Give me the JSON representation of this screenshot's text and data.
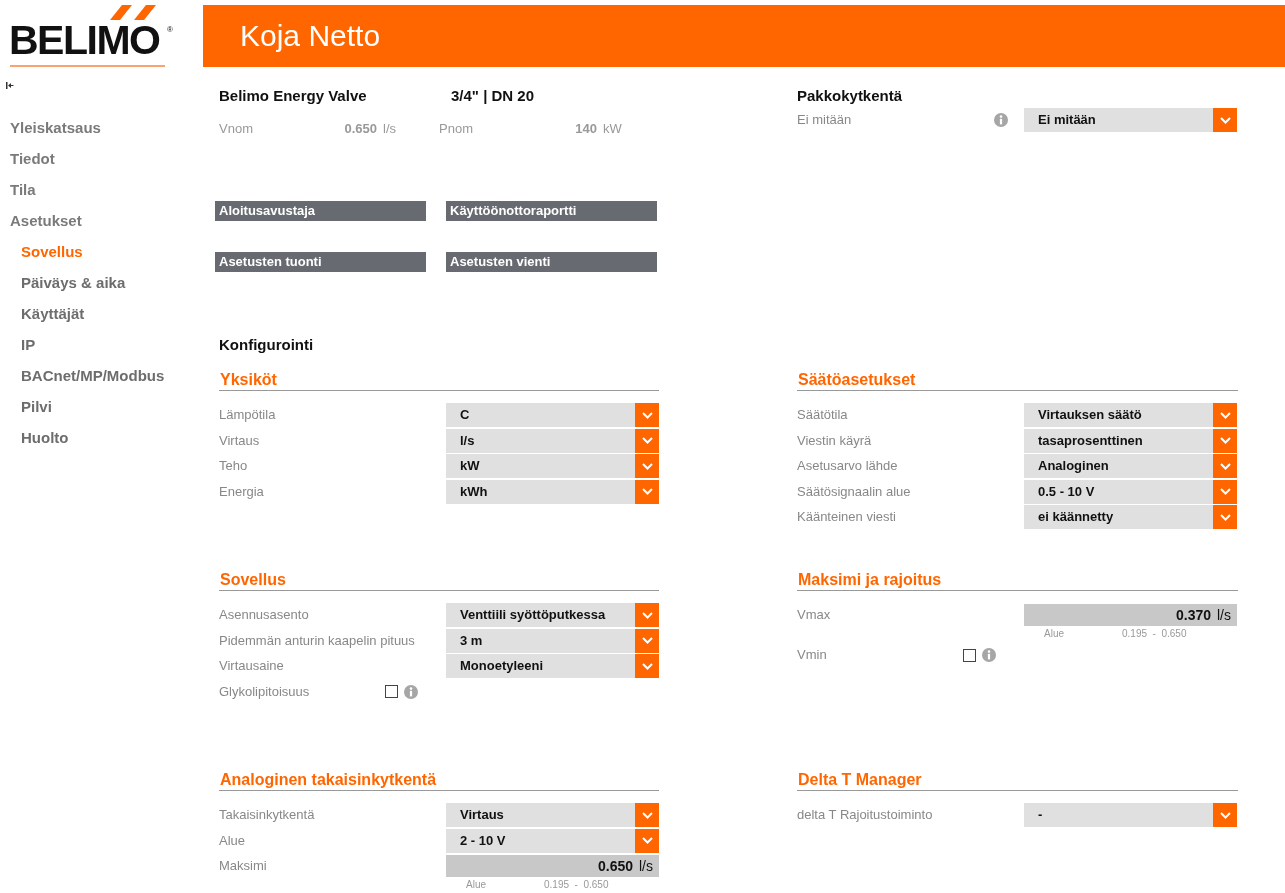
{
  "logo": {
    "text": "BELIMO",
    "mark": "®"
  },
  "header": {
    "title": "Koja Netto"
  },
  "sidebar": {
    "items": [
      {
        "label": "Yleiskatsaus",
        "selected": false
      },
      {
        "label": "Tiedot",
        "selected": false
      },
      {
        "label": "Tila",
        "selected": false
      },
      {
        "label": "Asetukset",
        "selected": false,
        "children": [
          {
            "label": "Sovellus",
            "selected": true
          },
          {
            "label": "Päiväys & aika",
            "selected": false
          },
          {
            "label": "Käyttäjät",
            "selected": false
          },
          {
            "label": "IP",
            "selected": false
          },
          {
            "label": "BACnet/MP/Modbus",
            "selected": false
          },
          {
            "label": "Pilvi",
            "selected": false
          },
          {
            "label": "Huolto",
            "selected": false
          }
        ]
      }
    ]
  },
  "device": {
    "name": "Belimo Energy Valve",
    "size": "3/4\" | DN 20",
    "specs": [
      {
        "label": "Vnom",
        "value": "0.650",
        "unit": "l/s"
      },
      {
        "label": "Pnom",
        "value": "140",
        "unit": "kW"
      }
    ]
  },
  "action_buttons": [
    "Aloitusavustaja",
    "Käyttöönottoraportti",
    "Asetusten tuonti",
    "Asetusten vienti"
  ],
  "override": {
    "title": "Pakkokytkentä",
    "rows": [
      {
        "kind": "select",
        "label": "Ei mitään",
        "info": true,
        "value": "Ei mitään"
      }
    ]
  },
  "config_title": "Konfigurointi",
  "sections": [
    {
      "title": "Yksiköt",
      "rows": [
        {
          "kind": "select",
          "label": "Lämpötila",
          "value": "C"
        },
        {
          "kind": "select",
          "label": "Virtaus",
          "value": "l/s"
        },
        {
          "kind": "select",
          "label": "Teho",
          "value": "kW"
        },
        {
          "kind": "select",
          "label": "Energia",
          "value": "kWh"
        }
      ]
    },
    {
      "title": "Säätöasetukset",
      "rows": [
        {
          "kind": "select",
          "label": "Säätötila",
          "value": "Virtauksen säätö"
        },
        {
          "kind": "select",
          "label": "Viestin käyrä",
          "value": "tasaprosenttinen"
        },
        {
          "kind": "select",
          "label": "Asetusarvo lähde",
          "value": "Analoginen"
        },
        {
          "kind": "select",
          "label": "Säätösignaalin alue",
          "value": "0.5 - 10 V"
        },
        {
          "kind": "select",
          "label": "Käänteinen viesti",
          "value": "ei käännetty"
        }
      ]
    },
    {
      "title": "Sovellus",
      "rows": [
        {
          "kind": "select",
          "label": "Asennusasento",
          "value": "Venttiili syöttöputkessa"
        },
        {
          "kind": "select",
          "label": "Pidemmän anturin kaapelin pituus",
          "value": "3 m"
        },
        {
          "kind": "select",
          "label": "Virtausaine",
          "value": "Monoetyleeni"
        },
        {
          "kind": "checkbox",
          "label": "Glykolipitoisuus",
          "info": true,
          "checked": false
        }
      ]
    },
    {
      "title": "Maksimi ja rajoitus",
      "rows": [
        {
          "kind": "number",
          "label": "Vmax",
          "value": "0.370",
          "unit": "l/s",
          "range_label": "Alue",
          "range": "0.195  -  0.650"
        },
        {
          "kind": "checkbox",
          "label": "Vmin",
          "info": true,
          "checked": false
        }
      ]
    },
    {
      "title": "Analoginen takaisinkytkentä",
      "rows": [
        {
          "kind": "select",
          "label": "Takaisinkytkentä",
          "value": "Virtaus"
        },
        {
          "kind": "select",
          "label": "Alue",
          "value": "2 - 10 V"
        },
        {
          "kind": "number",
          "label": "Maksimi",
          "value": "0.650",
          "unit": "l/s",
          "range_label": "Alue",
          "range": "0.195  -  0.650"
        }
      ]
    },
    {
      "title": "Delta T Manager",
      "rows": [
        {
          "kind": "select",
          "label": "delta T Rajoitustoiminto",
          "value": "-"
        }
      ]
    }
  ]
}
